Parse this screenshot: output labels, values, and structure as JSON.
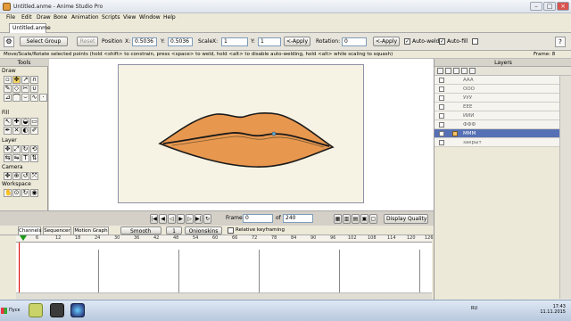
{
  "window": {
    "title": "Untitled.anme - Anime Studio Pro"
  },
  "menu": [
    "File",
    "Edit",
    "Draw",
    "Bone",
    "Animation",
    "Scripts",
    "View",
    "Window",
    "Help"
  ],
  "doc_tab": "Untitled.anme",
  "toolbar": {
    "select_group": "Select Group",
    "reset": "Reset",
    "position_label": "Position",
    "x_label": "X:",
    "x_value": "0.5036",
    "y_label": "Y:",
    "y_value": "0.5036",
    "scale_label": "Scale",
    "sx_label": "X:",
    "sx_value": "1",
    "sy_label": "Y:",
    "sy_value": "1",
    "apply1": "<-Apply",
    "rotation_label": "Rotation:",
    "rotation_value": "0",
    "apply2": "<-Apply",
    "autoweld": "Auto-weld",
    "autofill": "Auto-fill"
  },
  "hint": "Move/Scale/Rotate selected points (hold <shift> to constrain, press <space> to weld, hold <alt> to disable auto-welding, hold <alt> while scaling to squash)",
  "frame_label": "Frame: 8",
  "tools": {
    "header": "Tools",
    "sections": [
      "Draw",
      "Fill",
      "Layer",
      "Camera",
      "Workspace"
    ]
  },
  "layers": {
    "header": "Layers",
    "items": [
      {
        "name": "AAA",
        "selected": false
      },
      {
        "name": "OOO",
        "selected": false
      },
      {
        "name": "УУУ",
        "selected": false
      },
      {
        "name": "EEE",
        "selected": false
      },
      {
        "name": "ИИИ",
        "selected": false
      },
      {
        "name": "ФФФ",
        "selected": false
      },
      {
        "name": "MMM",
        "selected": true
      },
      {
        "name": "закрыт",
        "selected": false
      }
    ]
  },
  "playback": {
    "frame_label": "Frame",
    "frame_value": "0",
    "of_label": "of",
    "total_frames": "240",
    "quality": "Display Quality"
  },
  "timeline": {
    "tabs": [
      "Channels",
      "Sequencer",
      "Motion Graph"
    ],
    "interp": "Smooth",
    "interp_num": "1",
    "onionskins": "Onionskins",
    "relative": "Relative keyframing",
    "ticks": [
      "6",
      "12",
      "18",
      "24",
      "30",
      "36",
      "42",
      "48",
      "54",
      "60",
      "66",
      "72",
      "78",
      "84",
      "90",
      "96",
      "102",
      "108",
      "114",
      "120",
      "126"
    ]
  },
  "taskbar": {
    "start": "Пуск",
    "lang": "RU",
    "time": "17:43",
    "date": "11.11.2015"
  },
  "colors": {
    "lip_fill": "#e8974f",
    "lip_outline": "#1a1a1a",
    "selected_layer": "#5670b5"
  }
}
